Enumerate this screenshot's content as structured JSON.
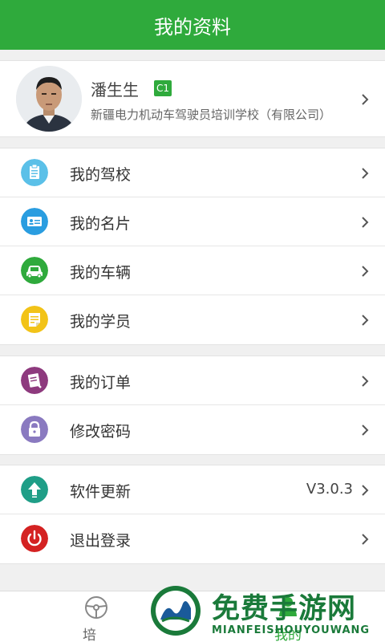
{
  "header": {
    "title": "我的资料"
  },
  "profile": {
    "name": "潘生生",
    "badge": "C1",
    "school": "新疆电力机动车驾驶员培训学校（有限公司）"
  },
  "groups": [
    {
      "items": [
        {
          "label": "我的驾校",
          "icon": "clipboard-icon",
          "color": "#5bc0e8"
        },
        {
          "label": "我的名片",
          "icon": "id-card-icon",
          "color": "#2a9de0"
        },
        {
          "label": "我的车辆",
          "icon": "car-icon",
          "color": "#2faa3c"
        },
        {
          "label": "我的学员",
          "icon": "note-icon",
          "color": "#f2c318"
        }
      ]
    },
    {
      "items": [
        {
          "label": "我的订单",
          "icon": "order-icon",
          "color": "#8e3a7e"
        },
        {
          "label": "修改密码",
          "icon": "lock-icon",
          "color": "#8a7ac0"
        }
      ]
    },
    {
      "items": [
        {
          "label": "软件更新",
          "icon": "upload-icon",
          "color": "#1f9e87",
          "value": "V3.0.3"
        },
        {
          "label": "退出登录",
          "icon": "power-icon",
          "color": "#d42222"
        }
      ]
    }
  ],
  "tabbar": {
    "tabs": [
      {
        "label": "培训",
        "icon": "steering-wheel-icon"
      },
      {
        "label": "我的",
        "icon": "person-icon"
      }
    ]
  },
  "watermark": {
    "title": "免费手游网",
    "subtitle": "MIANFEISHOUYOUWANG"
  },
  "colors": {
    "brand_green": "#2faa3c"
  }
}
